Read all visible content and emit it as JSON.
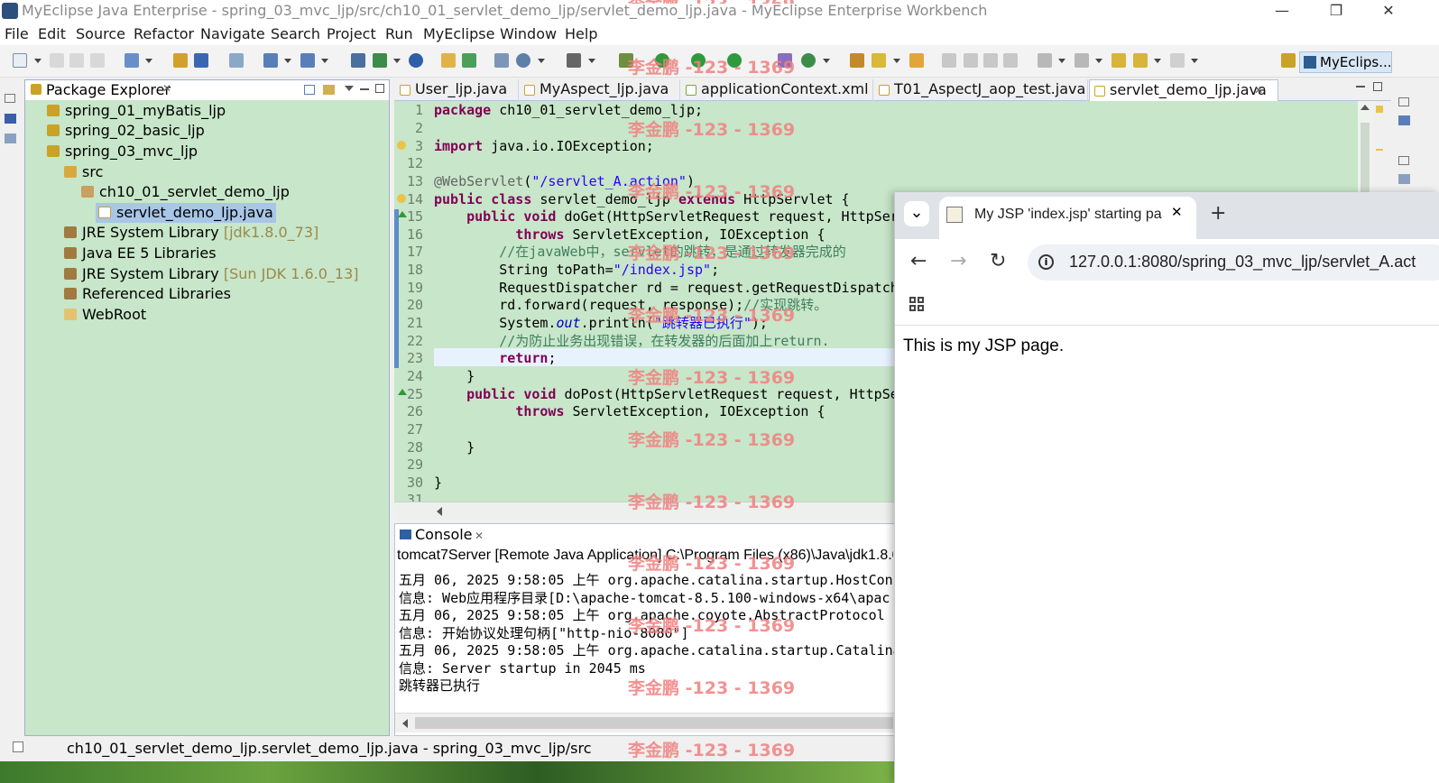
{
  "window": {
    "title": "MyEclipse Java Enterprise - spring_03_mvc_ljp/src/ch10_01_servlet_demo_ljp/servlet_demo_ljp.java - MyEclipse Enterprise Workbench",
    "controls": {
      "minimize": "—",
      "restore": "❐",
      "close": "✕"
    }
  },
  "menu": [
    "File",
    "Edit",
    "Source",
    "Refactor",
    "Navigate",
    "Search",
    "Project",
    "Run",
    "MyEclipse",
    "Window",
    "Help"
  ],
  "toolbar": {
    "perspective": "MyEclips..."
  },
  "package_explorer": {
    "title": "Package Explorer",
    "close": "✕",
    "items": [
      {
        "label": "spring_01_myBatis_ljp"
      },
      {
        "label": "spring_02_basic_ljp"
      },
      {
        "label": "spring_03_mvc_ljp"
      },
      {
        "label": "src"
      },
      {
        "label": "ch10_01_servlet_demo_ljp"
      },
      {
        "label": "servlet_demo_ljp.java"
      },
      {
        "label": "JRE System Library",
        "extra": "[jdk1.8.0_73]"
      },
      {
        "label": "Java EE 5 Libraries"
      },
      {
        "label": "JRE System Library",
        "extra": "[Sun JDK 1.6.0_13]"
      },
      {
        "label": "Referenced Libraries"
      },
      {
        "label": "WebRoot"
      }
    ]
  },
  "editor": {
    "tabs": [
      "User_ljp.java",
      "MyAspect_ljp.java",
      "applicationContext.xml",
      "T01_AspectJ_aop_test.java",
      "servlet_demo_ljp.java"
    ],
    "active_tab_close": "✕",
    "line_numbers": [
      "1",
      "2",
      "3",
      "12",
      "13",
      "14",
      "15",
      "16",
      "17",
      "18",
      "19",
      "20",
      "21",
      "22",
      "23",
      "24",
      "25",
      "26",
      "27",
      "28",
      "29",
      "30",
      "31"
    ],
    "code": {
      "l1_kw": "package",
      "l1_rest": " ch10_01_servlet_demo_ljp;",
      "l3_kw": "import",
      "l3_rest": " java.io.IOException;",
      "l13_ann": "@WebServlet",
      "l13_p1": "(",
      "l13_str": "\"/servlet_A.action\"",
      "l13_p2": ")",
      "l14_kw1": "public",
      "l14_kw2": "class",
      "l14_mid": " servlet_demo_ljp ",
      "l14_kw3": "extends",
      "l14_rest": " HttpServlet {",
      "l15_kw1": "public",
      "l15_kw2": "void",
      "l15_rest": " doGet(HttpServletRequest request, HttpServ",
      "l16_kw": "throws",
      "l16_rest": " ServletException, IOException {",
      "l17_cmt": "//在javaWeb中，servlet的跳转，是通过转发器完成的",
      "l18_pre": "        String toPath=",
      "l18_str": "\"/index.jsp\"",
      "l18_post": ";",
      "l19": "        RequestDispatcher rd = request.getRequestDispatche",
      "l20_pre": "        rd.forward(request, response);",
      "l20_cmt": "//实现跳转。",
      "l21_pre": "        System.",
      "l21_fld": "out",
      "l21_mid": ".println(",
      "l21_str": "\"跳转器已执行\"",
      "l21_post": ");",
      "l22_cmt": "//为防止业务出现错误，在转发器的后面加上return.",
      "l23_kw": "return",
      "l23_post": ";",
      "l24": "    }",
      "l25_kw1": "public",
      "l25_kw2": "void",
      "l25_rest": " doPost(HttpServletRequest request, HttpSer",
      "l26_kw": "throws",
      "l26_rest": " ServletException, IOException {",
      "l28": "    }",
      "l30": "}"
    }
  },
  "console": {
    "title": "Console",
    "close": "✕",
    "description": "tomcat7Server [Remote Java Application] C:\\Program Files (x86)\\Java\\jdk1.8.0",
    "lines": [
      "五月 06, 2025 9:58:05 上午 org.apache.catalina.startup.HostConfi",
      "信息: Web应用程序目录[D:\\apache-tomcat-8.5.100-windows-x64\\apac",
      "五月 06, 2025 9:58:05 上午 org.apache.coyote.AbstractProtocol st",
      "信息: 开始协议处理句柄[\"http-nio-8080\"]",
      "五月 06, 2025 9:58:05 上午 org.apache.catalina.startup.Catalina",
      "信息: Server startup in 2045 ms",
      "跳转器已执行"
    ]
  },
  "statusbar": {
    "text": "ch10_01_servlet_demo_ljp.servlet_demo_ljp.java - spring_03_mvc_ljp/src"
  },
  "browser": {
    "tab_title": "My JSP 'index.jsp' starting pa",
    "tab_close": "✕",
    "new_tab": "+",
    "tab_list": "⌄",
    "url": "127.0.0.1:8080/spring_03_mvc_ljp/servlet_A.act",
    "page_text": "This is my JSP page."
  },
  "watermark": "李金鹏 -123 - 1369",
  "colors": {
    "editor_bg": "#c8e6c9",
    "keyword": "#7f0055",
    "string": "#2a00ff",
    "comment": "#3f7f5f",
    "watermark": "#f08080"
  }
}
